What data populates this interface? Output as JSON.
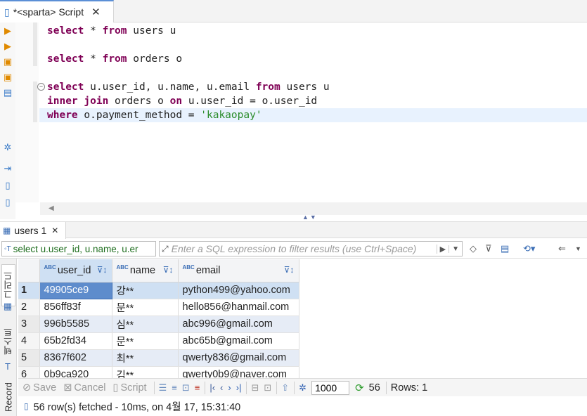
{
  "editor_tab": {
    "title": "*<sparta> Script",
    "close": "✕"
  },
  "editor": {
    "lines": [
      {
        "parts": [
          [
            "kw",
            "select"
          ],
          [
            "t",
            " * "
          ],
          [
            "kw",
            "from"
          ],
          [
            "t",
            " users u"
          ]
        ]
      },
      {
        "parts": [
          [
            "kw",
            "select"
          ],
          [
            "t",
            " * "
          ],
          [
            "kw",
            "from"
          ],
          [
            "t",
            " orders o"
          ]
        ]
      },
      {
        "parts": [
          [
            "kw",
            "select"
          ],
          [
            "t",
            " u.user_id, u.name, u.email "
          ],
          [
            "kw",
            "from"
          ],
          [
            "t",
            " users u"
          ]
        ]
      },
      {
        "parts": [
          [
            "kw",
            "inner join"
          ],
          [
            "t",
            " orders o "
          ],
          [
            "kw",
            "on"
          ],
          [
            "t",
            " u.user_id = o.user_id"
          ]
        ]
      },
      {
        "parts": [
          [
            "kw",
            "where"
          ],
          [
            "t",
            " o.payment_method = "
          ],
          [
            "str",
            "'kakaopay'"
          ]
        ]
      }
    ],
    "fold_toggle": "−"
  },
  "results_tab": {
    "label": "users 1",
    "close": "✕"
  },
  "filter": {
    "source_text": "select u.user_id, u.name, u.er",
    "placeholder": "Enter a SQL expression to filter results (use Ctrl+Space)"
  },
  "grid_vtabs": {
    "grid": "그리드",
    "text": "텍스트",
    "record": "Record"
  },
  "grid": {
    "columns": [
      {
        "name": "user_id",
        "type": "ABC"
      },
      {
        "name": "name",
        "type": "ABC"
      },
      {
        "name": "email",
        "type": "ABC"
      }
    ],
    "rows": [
      {
        "num": "1",
        "user_id": "49905ce9",
        "name": "강**",
        "email": "python499@yahoo.com"
      },
      {
        "num": "2",
        "user_id": "856ff83f",
        "name": "문**",
        "email": "hello856@hanmail.com"
      },
      {
        "num": "3",
        "user_id": "996b5585",
        "name": "심**",
        "email": "abc996@gmail.com"
      },
      {
        "num": "4",
        "user_id": "65b2fd34",
        "name": "문**",
        "email": "abc65b@gmail.com"
      },
      {
        "num": "5",
        "user_id": "8367f602",
        "name": "최**",
        "email": "qwerty836@gmail.com"
      },
      {
        "num": "6",
        "user_id": "0b9ca920",
        "name": "김**",
        "email": "qwerty0b9@naver.com"
      }
    ]
  },
  "toolbar": {
    "save": "Save",
    "cancel": "Cancel",
    "script": "Script",
    "max_rows": "1000",
    "fetched_count": "56",
    "rows_label": "Rows: 1"
  },
  "status": {
    "message": "56 row(s) fetched - 10ms, on 4월 17, 15:31:40"
  },
  "colors": {
    "keyword": "#7f0055",
    "string": "#2a8c2a",
    "selection": "#5e8ccc",
    "accent": "#3a6db5"
  }
}
